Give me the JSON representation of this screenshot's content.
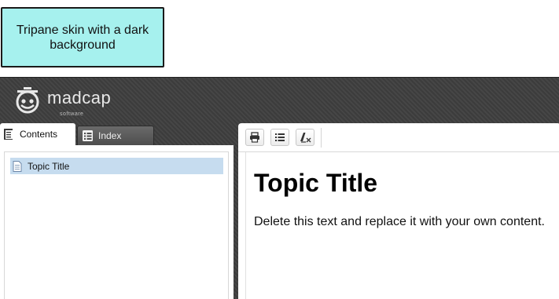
{
  "callout": {
    "text": "Tripane skin with a dark background"
  },
  "header": {
    "logo_icon": "madcap-logo-icon",
    "logo_text": "madcap",
    "logo_subtext": "software"
  },
  "nav": {
    "tabs": [
      {
        "label": "Contents",
        "icon": "contents-book-icon",
        "active": true
      },
      {
        "label": "Index",
        "icon": "index-list-icon",
        "active": false
      }
    ],
    "toc_items": [
      {
        "label": "Topic Title",
        "icon": "topic-document-icon",
        "selected": true
      }
    ]
  },
  "toolbar": {
    "buttons": [
      {
        "name": "print",
        "icon": "printer-icon"
      },
      {
        "name": "expand-all",
        "icon": "list-icon"
      },
      {
        "name": "remove-highlight",
        "icon": "remove-highlight-icon"
      }
    ]
  },
  "topic": {
    "title": "Topic Title",
    "body": "Delete this text and replace it with your own content."
  },
  "colors": {
    "callout_bg": "#a6f1ee",
    "skin_bg": "#3f3f3f",
    "toc_selected": "#c6dcef"
  }
}
